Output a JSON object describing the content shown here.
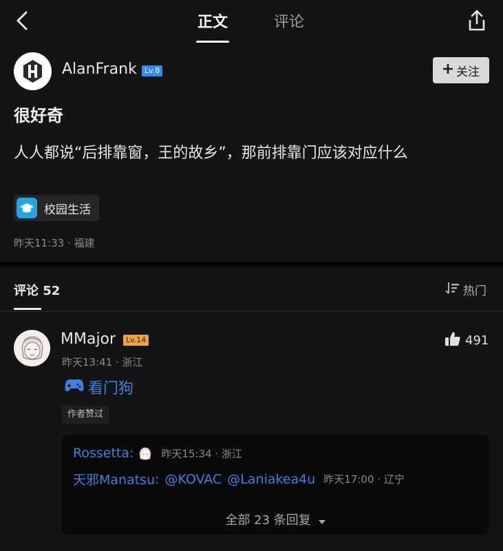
{
  "header": {
    "tabs": [
      {
        "label": "正文",
        "active": true
      },
      {
        "label": "评论",
        "active": false
      }
    ]
  },
  "post": {
    "author": {
      "name": "AlanFrank",
      "level": "Lv.8"
    },
    "follow_label": "关注",
    "title": "很好奇",
    "body": "人人都说“后排靠窗，王的故乡”，那前排靠门应该对应什么",
    "topic": "校园生活",
    "meta": "昨天11:33 · 福建"
  },
  "comments": {
    "header_label": "评论 52",
    "sort_label": "热门",
    "items": [
      {
        "user": "MMajor",
        "level": "Lv.14",
        "meta": "昨天13:41 · 浙江",
        "likes": "491",
        "content": "看门狗",
        "author_liked": "作者赞过",
        "replies": [
          {
            "user": "Rossetta",
            "colon": ":",
            "time": "昨天15:34 · 浙江"
          },
          {
            "user": "天邪Manatsu",
            "colon": ":",
            "mentions": [
              "@KOVAC",
              "@Laniakea4u"
            ],
            "time": "昨天17:00 · 辽宁"
          }
        ],
        "all_replies_label": "全部 23 条回复"
      }
    ]
  },
  "colors": {
    "background": "#141414",
    "link_blue": "#3f7fe0",
    "level_blue": "#2f8cf4",
    "level_orange": "#f2a33a",
    "topic_icon": "#22a6e6"
  },
  "icons": [
    "back-arrow-icon",
    "share-icon",
    "plus-icon",
    "graduation-cap-icon",
    "sort-icon",
    "thumbs-up-icon",
    "gamepad-icon",
    "caret-down-icon"
  ]
}
